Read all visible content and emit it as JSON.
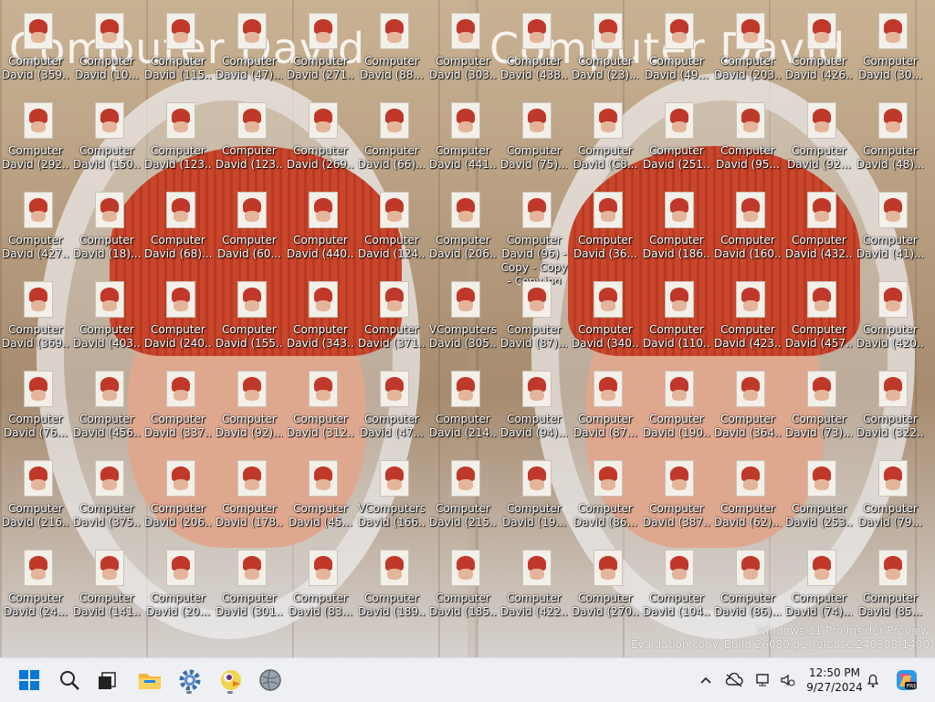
{
  "wallpaper": {
    "left_title": "Computer David",
    "right_title": "Computer David"
  },
  "desktop": {
    "icons": [
      {
        "line1": "Computer",
        "line2": "David (359..."
      },
      {
        "line1": "Computer",
        "line2": "David (10..."
      },
      {
        "line1": "Computer",
        "line2": "David (115..."
      },
      {
        "line1": "Computer",
        "line2": "David (47)..."
      },
      {
        "line1": "Computer",
        "line2": "David (271..."
      },
      {
        "line1": "Computer",
        "line2": "David (88..."
      },
      {
        "line1": "Computer",
        "line2": "David (303..."
      },
      {
        "line1": "Computer",
        "line2": "David (438..."
      },
      {
        "line1": "Computer",
        "line2": "David (23)..."
      },
      {
        "line1": "Computer",
        "line2": "David (49..."
      },
      {
        "line1": "Computer",
        "line2": "David (203..."
      },
      {
        "line1": "Computer",
        "line2": "David (426..."
      },
      {
        "line1": "Computer",
        "line2": "David (30..."
      },
      {
        "line1": "Computer",
        "line2": "David (292..."
      },
      {
        "line1": "Computer",
        "line2": "David (150..."
      },
      {
        "line1": "Computer",
        "line2": "David (123..."
      },
      {
        "line1": "Computer",
        "line2": "David (123..."
      },
      {
        "line1": "Computer",
        "line2": "David (269..."
      },
      {
        "line1": "Computer",
        "line2": "David (66)..."
      },
      {
        "line1": "Computer",
        "line2": "David (441..."
      },
      {
        "line1": "Computer",
        "line2": "David (75)..."
      },
      {
        "line1": "Computer",
        "line2": "David (C8..."
      },
      {
        "line1": "Computer",
        "line2": "David (251..."
      },
      {
        "line1": "Computer",
        "line2": "David (95..."
      },
      {
        "line1": "Computer",
        "line2": "David (92..."
      },
      {
        "line1": "Computer",
        "line2": "David (48)..."
      },
      {
        "line1": "Computer",
        "line2": "David (427..."
      },
      {
        "line1": "Computer",
        "line2": "David (18)..."
      },
      {
        "line1": "Computer",
        "line2": "David (68)..."
      },
      {
        "line1": "Computer",
        "line2": "David (60..."
      },
      {
        "line1": "Computer",
        "line2": "David (440..."
      },
      {
        "line1": "Computer",
        "line2": "David (124..."
      },
      {
        "line1": "Computer",
        "line2": "David (206..."
      },
      {
        "line1": "Computer",
        "line2": "David (96) -",
        "line3": "Copy - Copy",
        "line4": "- Copy.jpg"
      },
      {
        "line1": "Computer",
        "line2": "David (36..."
      },
      {
        "line1": "Computer",
        "line2": "David (186..."
      },
      {
        "line1": "Computer",
        "line2": "David (160..."
      },
      {
        "line1": "Computer",
        "line2": "David (432..."
      },
      {
        "line1": "Computer",
        "line2": "David (41)..."
      },
      {
        "line1": "Computer",
        "line2": "David (369..."
      },
      {
        "line1": "Computer",
        "line2": "David (403..."
      },
      {
        "line1": "Computer",
        "line2": "David (240..."
      },
      {
        "line1": "Computer",
        "line2": "David (155..."
      },
      {
        "line1": "Computer",
        "line2": "David (343..."
      },
      {
        "line1": "Computer",
        "line2": "David (371..."
      },
      {
        "line1": "VComputers",
        "line2": "David (305..."
      },
      {
        "line1": "Computer",
        "line2": "David (87)..."
      },
      {
        "line1": "Computer",
        "line2": "David (340..."
      },
      {
        "line1": "Computer",
        "line2": "David (110..."
      },
      {
        "line1": "Computer",
        "line2": "David (423..."
      },
      {
        "line1": "Computer",
        "line2": "David (457..."
      },
      {
        "line1": "Computer",
        "line2": "David (420..."
      },
      {
        "line1": "Computer",
        "line2": "David (76..."
      },
      {
        "line1": "Computer",
        "line2": "David (456..."
      },
      {
        "line1": "Computer",
        "line2": "David (337..."
      },
      {
        "line1": "Computer",
        "line2": "David (92)..."
      },
      {
        "line1": "Computer",
        "line2": "David (312..."
      },
      {
        "line1": "Computer",
        "line2": "David (47..."
      },
      {
        "line1": "Computer",
        "line2": "David (214..."
      },
      {
        "line1": "Computer",
        "line2": "David (94)..."
      },
      {
        "line1": "Computer",
        "line2": "David (87..."
      },
      {
        "line1": "Computer",
        "line2": "David (190..."
      },
      {
        "line1": "Computer",
        "line2": "David (364..."
      },
      {
        "line1": "Computer",
        "line2": "David (73)..."
      },
      {
        "line1": "Computer",
        "line2": "David (322..."
      },
      {
        "line1": "Computer",
        "line2": "David (216..."
      },
      {
        "line1": "Computer",
        "line2": "David (375..."
      },
      {
        "line1": "Computer",
        "line2": "David (206..."
      },
      {
        "line1": "Computer",
        "line2": "David (178..."
      },
      {
        "line1": "Computer",
        "line2": "David (45..."
      },
      {
        "line1": "VComputers",
        "line2": "David (166..."
      },
      {
        "line1": "Computer",
        "line2": "David (215..."
      },
      {
        "line1": "Computer",
        "line2": "David (19..."
      },
      {
        "line1": "Computer",
        "line2": "David (86..."
      },
      {
        "line1": "Computer",
        "line2": "David (387..."
      },
      {
        "line1": "Computer",
        "line2": "David (62)..."
      },
      {
        "line1": "Computer",
        "line2": "David (253..."
      },
      {
        "line1": "Computer",
        "line2": "David (79..."
      },
      {
        "line1": "Computer",
        "line2": "David (24..."
      },
      {
        "line1": "Computer",
        "line2": "David (141..."
      },
      {
        "line1": "Computer",
        "line2": "David (20..."
      },
      {
        "line1": "Computer",
        "line2": "David (301..."
      },
      {
        "line1": "Computer",
        "line2": "David (83..."
      },
      {
        "line1": "Computer",
        "line2": "David (189..."
      },
      {
        "line1": "Computer",
        "line2": "David (185..."
      },
      {
        "line1": "Computer",
        "line2": "David (422..."
      },
      {
        "line1": "Computer",
        "line2": "David (270..."
      },
      {
        "line1": "Computer",
        "line2": "David (104..."
      },
      {
        "line1": "Computer",
        "line2": "David (86)..."
      },
      {
        "line1": "Computer",
        "line2": "David (74)..."
      },
      {
        "line1": "Computer",
        "line2": "David (85..."
      }
    ]
  },
  "watermark": {
    "line1": "Windows 11 Pro Insider Preview",
    "line2": "Evaluation copy. Build 26080.ge_release.240308-1400"
  },
  "taskbar": {
    "pinned": [
      {
        "name": "start-button",
        "icon": "windows-logo-icon"
      },
      {
        "name": "search-button",
        "icon": "search-icon"
      },
      {
        "name": "task-view-button",
        "icon": "task-view-icon"
      },
      {
        "name": "file-explorer-button",
        "icon": "folder-icon"
      },
      {
        "name": "settings-button",
        "icon": "gear-icon"
      },
      {
        "name": "app-bird-button",
        "icon": "bird-icon"
      },
      {
        "name": "app-globe-button",
        "icon": "globe-icon"
      }
    ],
    "clock": {
      "time": "12:50 PM",
      "date": "9/27/2024"
    },
    "accent": "#1a73e8"
  }
}
